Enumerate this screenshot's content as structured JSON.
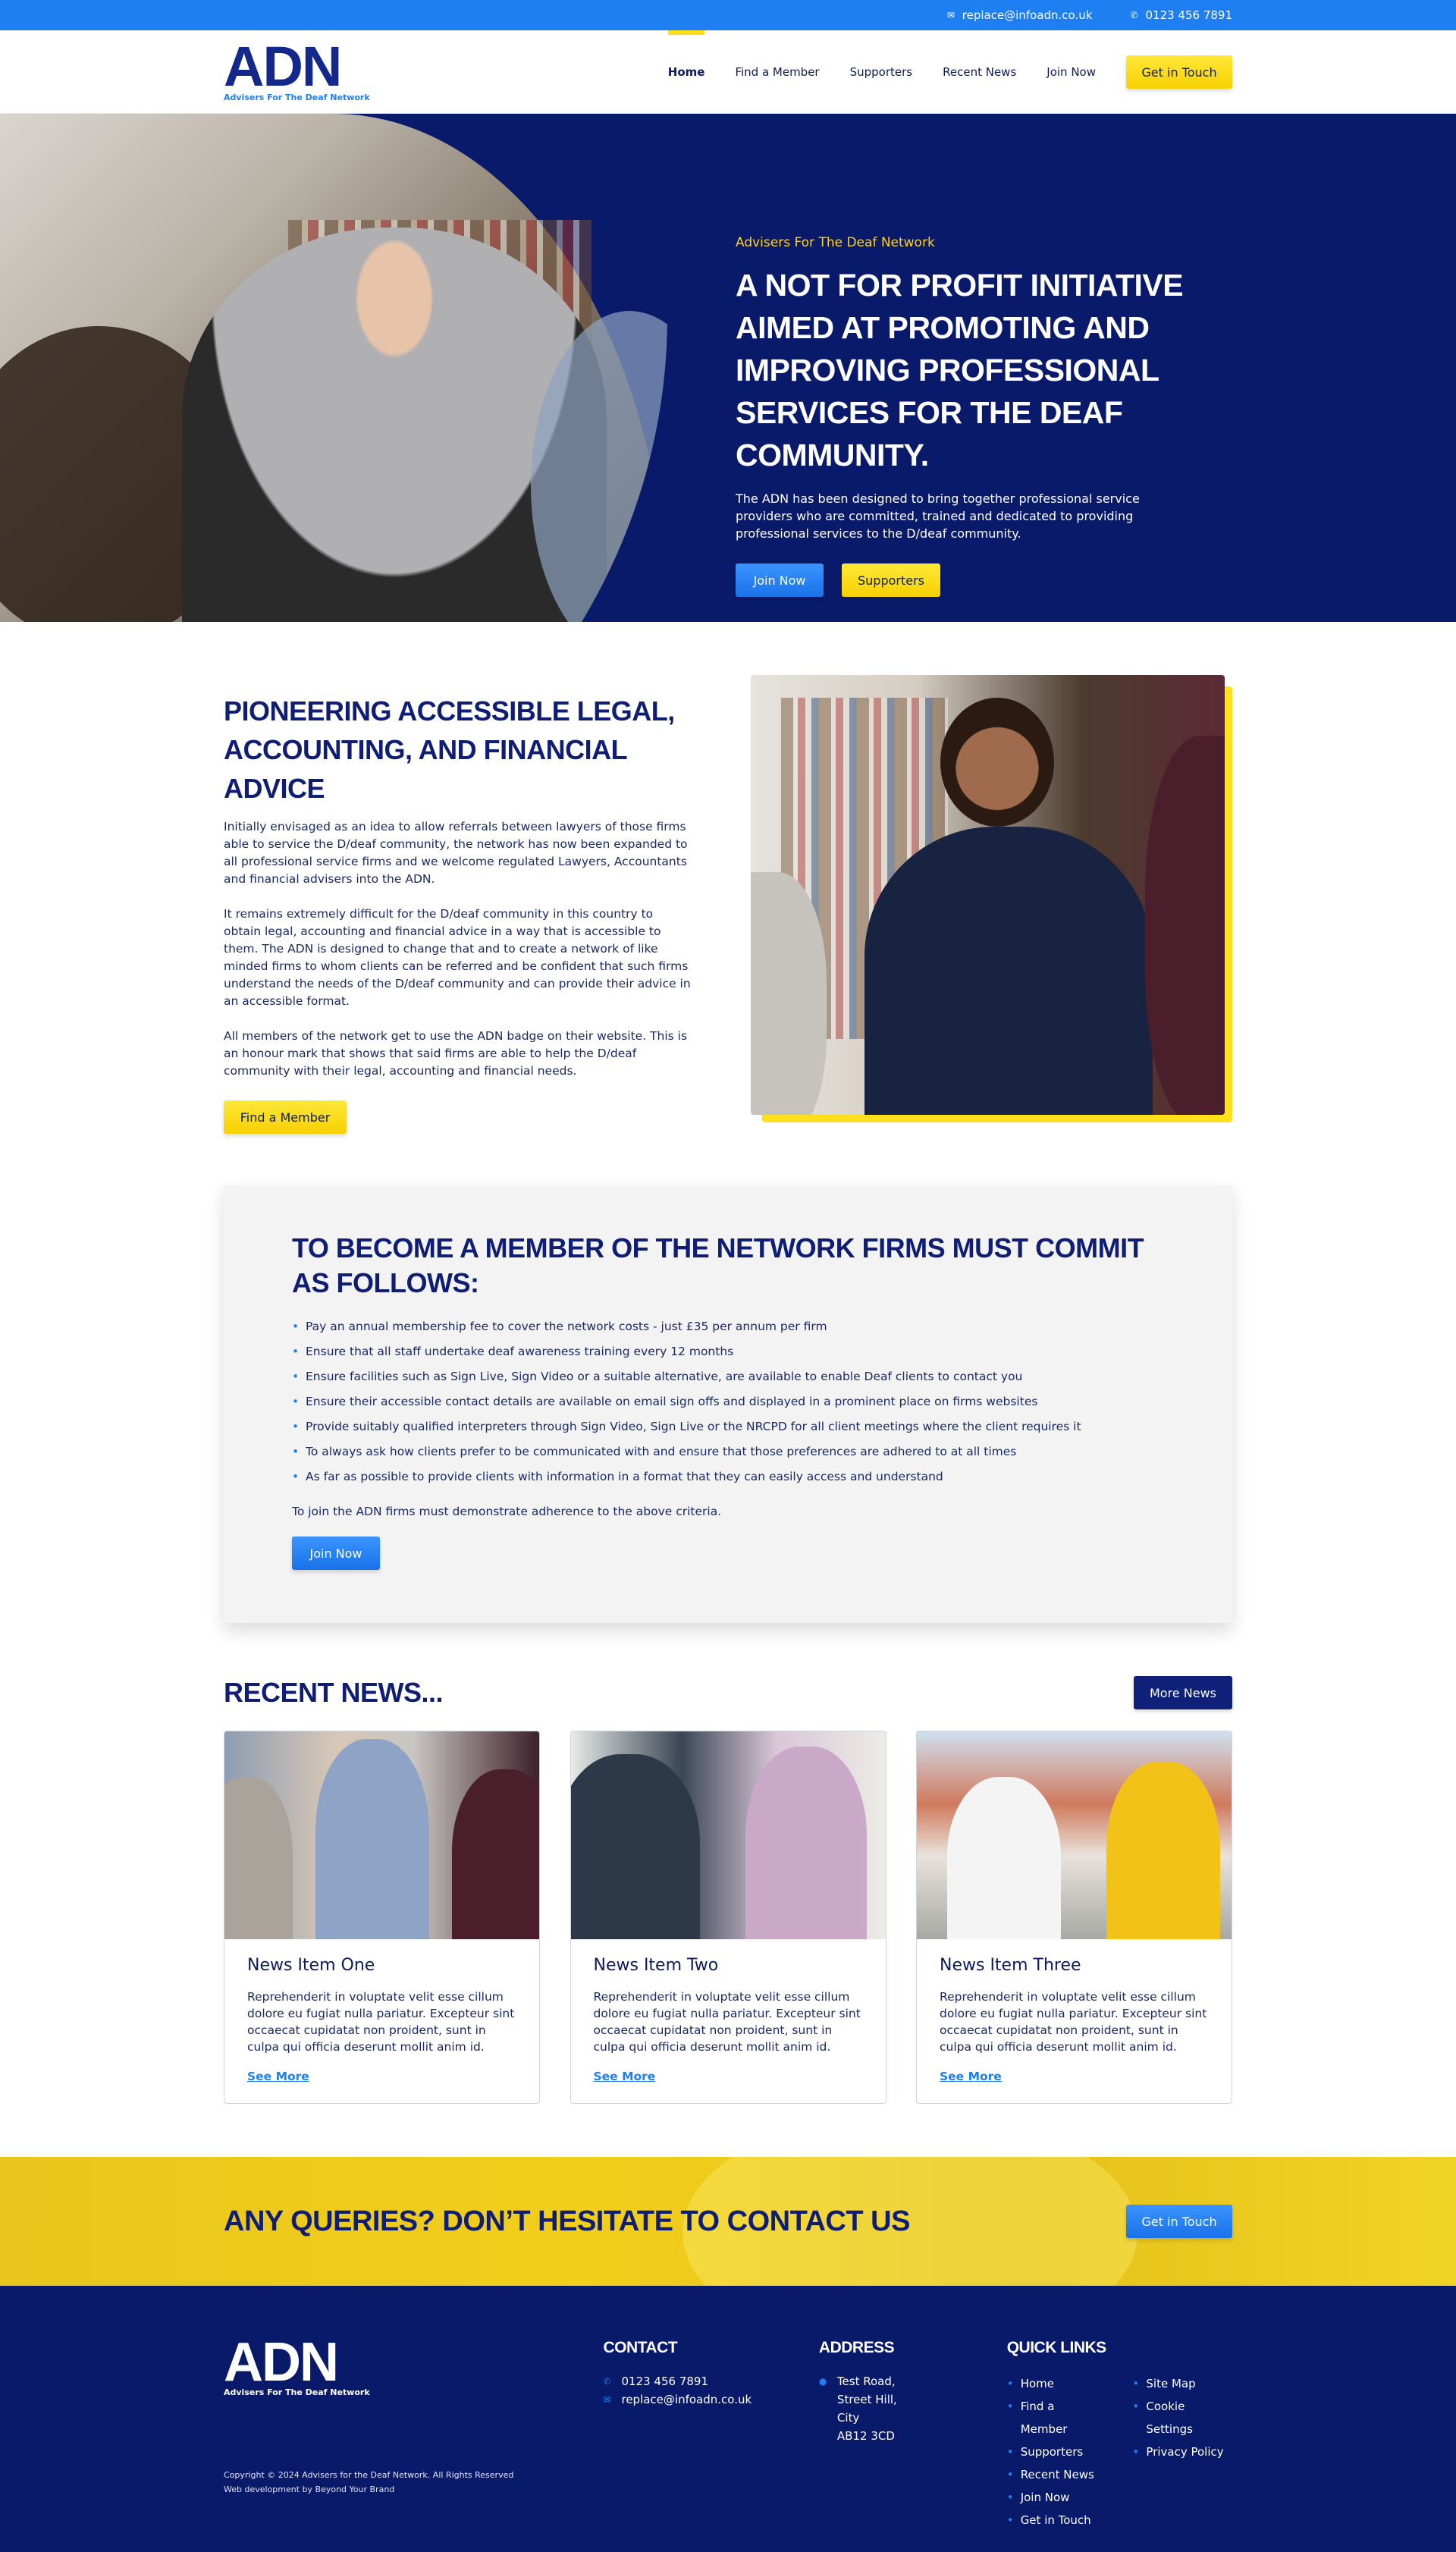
{
  "topbar": {
    "email": "replace@infoadn.co.uk",
    "phone": "0123 456 7891"
  },
  "brand": {
    "logo_text": "ADN",
    "tagline": "Advisers For The Deaf Network",
    "colors": {
      "navy": "#0a1a6b",
      "blue": "#1e7ff2",
      "yellow": "#ffe01b"
    }
  },
  "nav": {
    "items": [
      "Home",
      "Find  a Member",
      "Supporters",
      "Recent News",
      "Join Now"
    ],
    "active": "Home",
    "cta": "Get in Touch"
  },
  "hero": {
    "eyebrow": "Advisers For The Deaf Network",
    "title": "A not for profit initiative aimed at promoting and improving professional services for the deaf community.",
    "text": "The ADN has been designed to bring together professional service providers who are committed, trained and dedicated to providing professional services to the D/deaf community.",
    "btn_primary": "Join Now",
    "btn_secondary": "Supporters"
  },
  "about": {
    "title": "Pioneering accessible legal, accounting, and financial advice",
    "paragraphs": [
      "Initially envisaged as an idea to allow referrals between lawyers of those firms able to service the D/deaf community, the network has now been expanded to all professional service firms and we welcome regulated Lawyers, Accountants and financial advisers into the ADN.",
      "It remains extremely difficult for the D/deaf community in this country to obtain legal, accounting and financial advice in a way that is accessible to them. The ADN is designed to change that and to create a network of like minded firms to whom clients can be referred and be confident that such firms understand the needs of the D/deaf community and can provide their advice in an accessible format.",
      "All members of the network get to use the ADN badge on their website. This is an honour mark that shows that said firms are able to help the D/deaf community with their legal, accounting and financial needs."
    ],
    "button": "Find a Member"
  },
  "membership": {
    "title": "To become a member of the network firms must commit as follows:",
    "items": [
      "Pay an annual membership fee to cover the network costs - just £35 per annum per firm",
      "Ensure that all staff undertake deaf awareness training every 12 months",
      "Ensure facilities such as Sign Live, Sign Video or a suitable alternative, are available to enable Deaf clients to contact you",
      "Ensure their accessible contact details are available on email sign offs and displayed in a prominent place on firms websites",
      "Provide suitably qualified interpreters through Sign Video, Sign Live or the NRCPD for all client meetings where the client requires it",
      "To always ask how clients prefer to be communicated with and ensure that those preferences are adhered to at all times",
      "As far as possible to provide clients with information in a format that they can easily access and understand"
    ],
    "note": "To join the ADN firms must demonstrate adherence to the above criteria.",
    "button": "Join Now"
  },
  "news": {
    "title": "Recent News...",
    "more_button": "More News",
    "cards": [
      {
        "title": "News Item One",
        "text": "Reprehenderit in voluptate velit esse cillum dolore eu fugiat nulla pariatur. Excepteur sint occaecat cupidatat non proident, sunt in culpa qui officia deserunt mollit anim id.",
        "link": "See More"
      },
      {
        "title": "News Item Two",
        "text": "Reprehenderit in voluptate velit esse cillum dolore eu fugiat nulla pariatur. Excepteur sint occaecat cupidatat non proident, sunt in culpa qui officia deserunt mollit anim id.",
        "link": "See More"
      },
      {
        "title": "News Item Three",
        "text": "Reprehenderit in voluptate velit esse cillum dolore eu fugiat nulla pariatur. Excepteur sint occaecat cupidatat non proident, sunt in culpa qui officia deserunt mollit anim id.",
        "link": "See More"
      }
    ]
  },
  "cta": {
    "title": "Any queries? Don’t hesitate to contact us",
    "button": "Get in Touch"
  },
  "footer": {
    "contact_title": "Contact",
    "phone": "0123 456 7891",
    "email": "replace@infoadn.co.uk",
    "address_title": "Address",
    "address_lines": [
      "Test Road,",
      "Street Hill,",
      "City",
      "AB12 3CD"
    ],
    "links_title": "Quick Links",
    "links_col1": [
      "Home",
      "Find a Member",
      "Supporters",
      "Recent News",
      "Join Now",
      "Get in Touch"
    ],
    "links_col2": [
      "Site Map",
      "Cookie Settings",
      "Privacy Policy"
    ],
    "copyright": "Copyright © 2024 Advisers for the Deaf Network. All Rights Reserved",
    "credit": "Web development by Beyond Your Brand"
  }
}
